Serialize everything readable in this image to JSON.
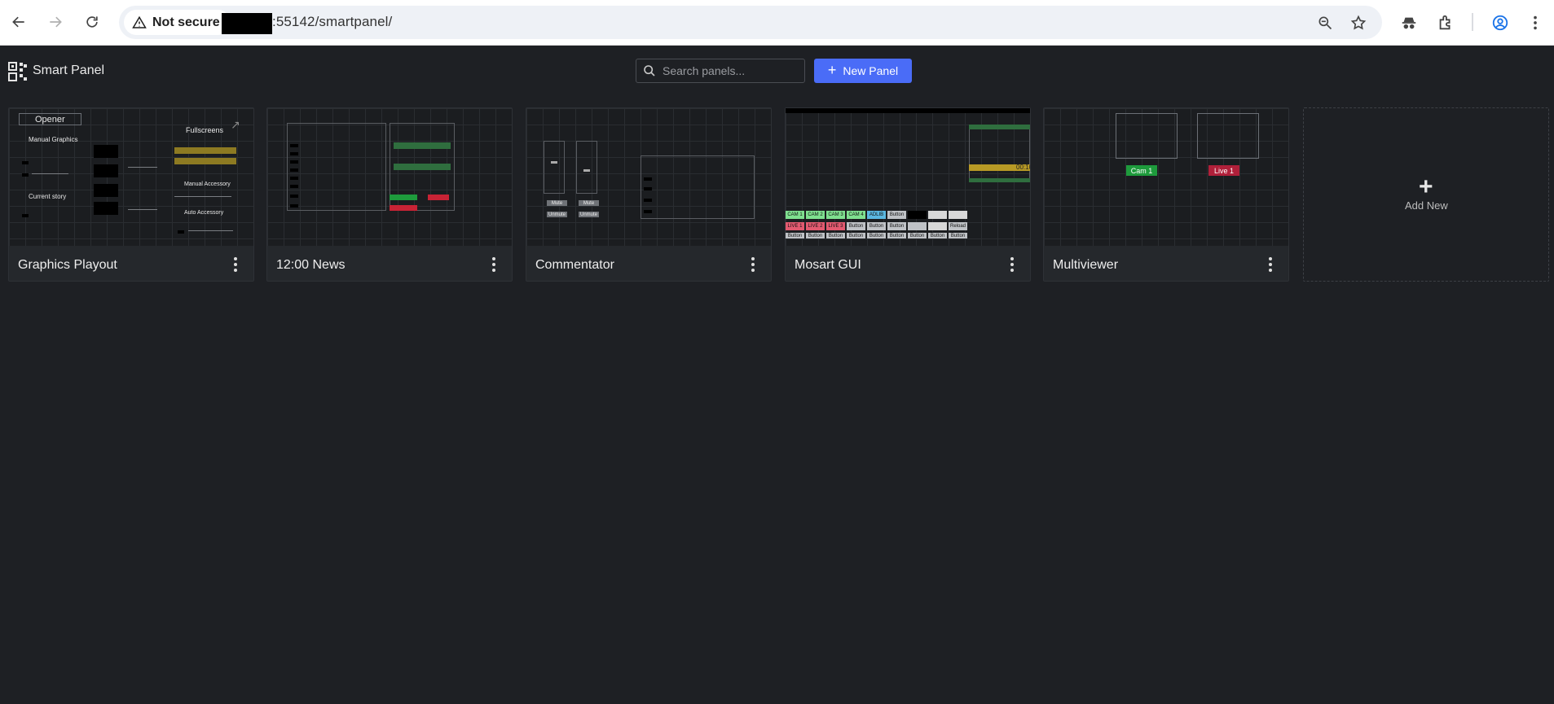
{
  "browser": {
    "security_label": "Not secure",
    "url": ":55142/smartpanel/"
  },
  "app": {
    "name": "Smart Panel",
    "search_placeholder": "Search panels...",
    "new_panel_label": "New Panel"
  },
  "panels": [
    {
      "title": "Graphics Playout",
      "preview": {
        "opener": "Opener",
        "manual_graphics": "Manual Graphics",
        "current_story": "Current story",
        "fullscreens": "Fullscreens",
        "manual_accessory": "Manual Accessory",
        "auto_accessory": "Auto Accessory"
      }
    },
    {
      "title": "12:00 News"
    },
    {
      "title": "Commentator",
      "preview": {
        "mute": "Mute",
        "unmute": "Unmute"
      }
    },
    {
      "title": "Mosart GUI",
      "preview": {
        "cams": [
          "CAM 1",
          "CAM 2",
          "CAM 3",
          "CAM 4",
          "ADLIB",
          "Button"
        ],
        "lives": [
          "LIVE 1",
          "LIVE 2",
          "LIVE 3",
          "Button",
          "Button",
          "Button"
        ],
        "buttons": [
          "Button",
          "Button",
          "Button",
          "Button",
          "Button",
          "Button",
          "Button",
          "Button",
          "Button"
        ],
        "reload": "Reload",
        "clock": "00:10"
      }
    },
    {
      "title": "Multiviewer",
      "preview": {
        "cam": "Cam 1",
        "live": "Live 1"
      }
    }
  ],
  "add_new_label": "Add New",
  "colors": {
    "accent": "#4a6cf7",
    "background": "#1e2024",
    "card": "#25282c",
    "cam_green": "#1e9b3c",
    "live_red": "#b0203a"
  }
}
